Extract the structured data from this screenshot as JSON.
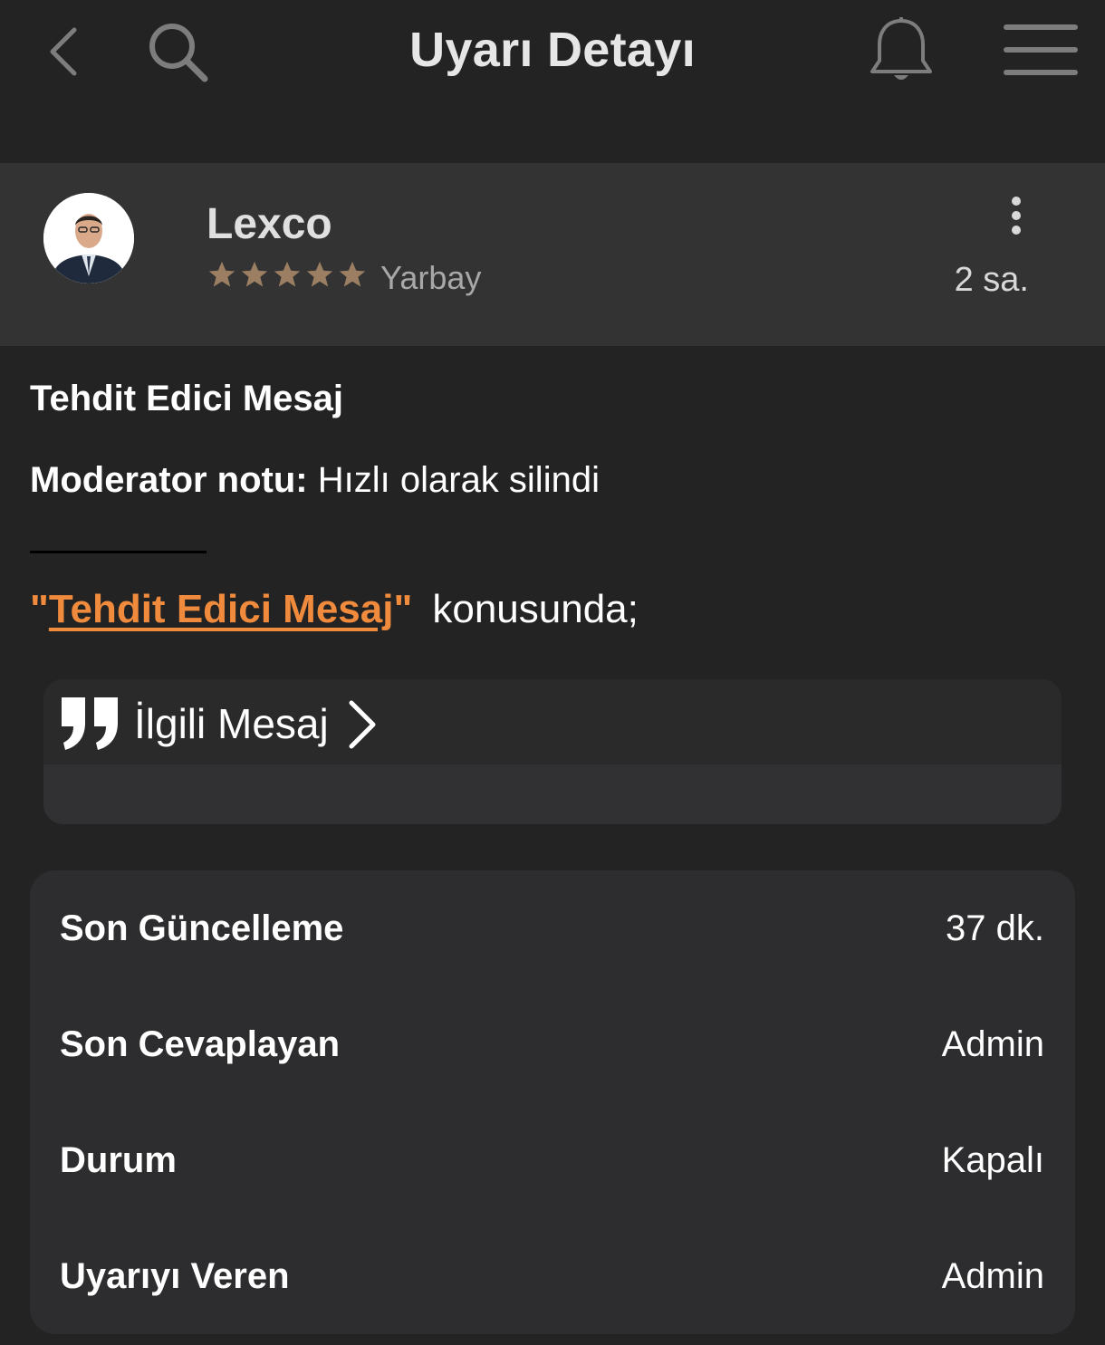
{
  "header": {
    "title": "Uyarı Detayı",
    "back_icon": "chevron-left-icon",
    "search_icon": "search-icon",
    "notification_icon": "bell-icon",
    "menu_icon": "hamburger-menu-icon"
  },
  "user": {
    "name": "Lexco",
    "rank": "Yarbay",
    "stars": 5,
    "time_ago": "2 sa.",
    "star_color": "#9c7f63"
  },
  "warning": {
    "title": "Tehdit Edici Mesaj",
    "moderator_note_label": "Moderator notu:",
    "moderator_note_text": "Hızlı olarak silindi",
    "topic_open_quote": "\"",
    "topic_link": "Tehdit Edici Mesaj",
    "topic_close_quote": "\"",
    "topic_suffix": "konusunda;",
    "accent_color": "#f08a3c"
  },
  "related": {
    "label": "İlgili Mesaj"
  },
  "info": {
    "rows": [
      {
        "label": "Son Güncelleme",
        "value": "37 dk."
      },
      {
        "label": "Son Cevaplayan",
        "value": "Admin"
      },
      {
        "label": "Durum",
        "value": "Kapalı"
      },
      {
        "label": "Uyarıyı Veren",
        "value": "Admin"
      }
    ]
  }
}
